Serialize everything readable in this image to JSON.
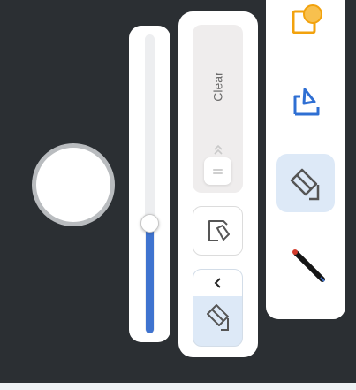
{
  "clear_slider": {
    "label": "Clear"
  },
  "size_slider": {
    "value_fraction": 0.37
  },
  "colors": {
    "accent": "#3f73cf",
    "active_bg": "#dde9f7",
    "shape_tool": "#f2a20d",
    "crop_tool": "#2f6fd3",
    "pen_tip": "#d33b2c"
  },
  "icons": {
    "shape_tool": "shape-icon",
    "select_tool": "lasso-select-icon",
    "eraser_tool": "eraser-icon",
    "pen_tool": "pen-icon",
    "pen_select": "pen-select-icon",
    "collapse": "chevron-left-icon",
    "clear_arrows": "chevron-up-icon"
  }
}
